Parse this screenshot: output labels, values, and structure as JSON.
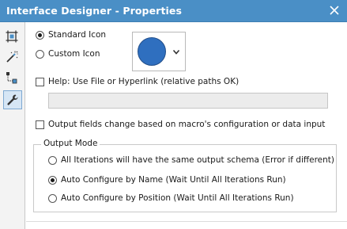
{
  "window": {
    "title": "Interface Designer - Properties"
  },
  "toolbar": {
    "tools": [
      {
        "icon": "layout-icon",
        "active": false
      },
      {
        "icon": "magic-wand-icon",
        "active": false
      },
      {
        "icon": "tree-icon",
        "active": false
      },
      {
        "icon": "wrench-icon",
        "active": true
      }
    ]
  },
  "icon_section": {
    "standard_icon_label": "Standard Icon",
    "custom_icon_label": "Custom Icon",
    "selected": "Standard Icon",
    "icon_color": "#2f6fbf"
  },
  "help": {
    "checkbox_label": "Help: Use File or Hyperlink (relative paths OK)",
    "checked": false,
    "path_value": ""
  },
  "output_fields": {
    "checkbox_label": "Output fields change based on macro's configuration or data input",
    "checked": false
  },
  "output_mode": {
    "title": "Output Mode",
    "options": [
      {
        "label": "All Iterations will have the same output schema (Error if different)",
        "selected": false
      },
      {
        "label": "Auto Configure by Name (Wait Until All Iterations Run)",
        "selected": true
      },
      {
        "label": "Auto Configure by Position (Wait Until All Iterations Run)",
        "selected": false
      }
    ]
  },
  "colors": {
    "titlebar": "#4a8fc6",
    "accent": "#2f6fbf"
  }
}
